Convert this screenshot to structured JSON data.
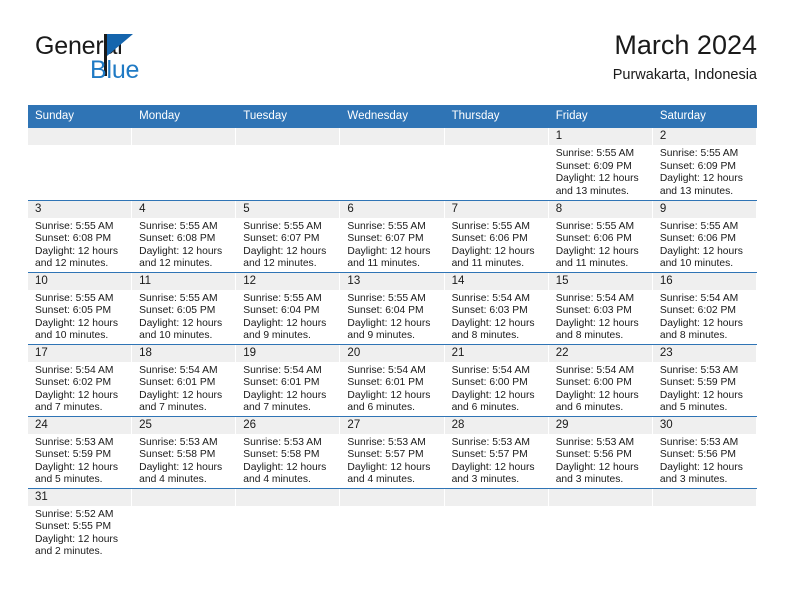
{
  "brand": {
    "name_top": "General",
    "name_bottom": "Blue",
    "accent_color": "#1f7ac4",
    "triangle_color": "#1565ad"
  },
  "header": {
    "title": "March 2024",
    "subtitle": "Purwakarta, Indonesia"
  },
  "theme": {
    "header_blue": "#2f74b5",
    "daynum_gray": "#efefef",
    "divider_blue": "#2f74b5"
  },
  "weekday_headers": [
    "Sunday",
    "Monday",
    "Tuesday",
    "Wednesday",
    "Thursday",
    "Friday",
    "Saturday"
  ],
  "weeks": [
    [
      {
        "day": "",
        "blank": true,
        "sunrise": "",
        "sunset": "",
        "daylight_line1": "",
        "daylight_line2": ""
      },
      {
        "day": "",
        "blank": true,
        "sunrise": "",
        "sunset": "",
        "daylight_line1": "",
        "daylight_line2": ""
      },
      {
        "day": "",
        "blank": true,
        "sunrise": "",
        "sunset": "",
        "daylight_line1": "",
        "daylight_line2": ""
      },
      {
        "day": "",
        "blank": true,
        "sunrise": "",
        "sunset": "",
        "daylight_line1": "",
        "daylight_line2": ""
      },
      {
        "day": "",
        "blank": true,
        "sunrise": "",
        "sunset": "",
        "daylight_line1": "",
        "daylight_line2": ""
      },
      {
        "day": "1",
        "blank": false,
        "sunrise": "Sunrise: 5:55 AM",
        "sunset": "Sunset: 6:09 PM",
        "daylight_line1": "Daylight: 12 hours",
        "daylight_line2": "and 13 minutes."
      },
      {
        "day": "2",
        "blank": false,
        "sunrise": "Sunrise: 5:55 AM",
        "sunset": "Sunset: 6:09 PM",
        "daylight_line1": "Daylight: 12 hours",
        "daylight_line2": "and 13 minutes."
      }
    ],
    [
      {
        "day": "3",
        "blank": false,
        "sunrise": "Sunrise: 5:55 AM",
        "sunset": "Sunset: 6:08 PM",
        "daylight_line1": "Daylight: 12 hours",
        "daylight_line2": "and 12 minutes."
      },
      {
        "day": "4",
        "blank": false,
        "sunrise": "Sunrise: 5:55 AM",
        "sunset": "Sunset: 6:08 PM",
        "daylight_line1": "Daylight: 12 hours",
        "daylight_line2": "and 12 minutes."
      },
      {
        "day": "5",
        "blank": false,
        "sunrise": "Sunrise: 5:55 AM",
        "sunset": "Sunset: 6:07 PM",
        "daylight_line1": "Daylight: 12 hours",
        "daylight_line2": "and 12 minutes."
      },
      {
        "day": "6",
        "blank": false,
        "sunrise": "Sunrise: 5:55 AM",
        "sunset": "Sunset: 6:07 PM",
        "daylight_line1": "Daylight: 12 hours",
        "daylight_line2": "and 11 minutes."
      },
      {
        "day": "7",
        "blank": false,
        "sunrise": "Sunrise: 5:55 AM",
        "sunset": "Sunset: 6:06 PM",
        "daylight_line1": "Daylight: 12 hours",
        "daylight_line2": "and 11 minutes."
      },
      {
        "day": "8",
        "blank": false,
        "sunrise": "Sunrise: 5:55 AM",
        "sunset": "Sunset: 6:06 PM",
        "daylight_line1": "Daylight: 12 hours",
        "daylight_line2": "and 11 minutes."
      },
      {
        "day": "9",
        "blank": false,
        "sunrise": "Sunrise: 5:55 AM",
        "sunset": "Sunset: 6:06 PM",
        "daylight_line1": "Daylight: 12 hours",
        "daylight_line2": "and 10 minutes."
      }
    ],
    [
      {
        "day": "10",
        "blank": false,
        "sunrise": "Sunrise: 5:55 AM",
        "sunset": "Sunset: 6:05 PM",
        "daylight_line1": "Daylight: 12 hours",
        "daylight_line2": "and 10 minutes."
      },
      {
        "day": "11",
        "blank": false,
        "sunrise": "Sunrise: 5:55 AM",
        "sunset": "Sunset: 6:05 PM",
        "daylight_line1": "Daylight: 12 hours",
        "daylight_line2": "and 10 minutes."
      },
      {
        "day": "12",
        "blank": false,
        "sunrise": "Sunrise: 5:55 AM",
        "sunset": "Sunset: 6:04 PM",
        "daylight_line1": "Daylight: 12 hours",
        "daylight_line2": "and 9 minutes."
      },
      {
        "day": "13",
        "blank": false,
        "sunrise": "Sunrise: 5:55 AM",
        "sunset": "Sunset: 6:04 PM",
        "daylight_line1": "Daylight: 12 hours",
        "daylight_line2": "and 9 minutes."
      },
      {
        "day": "14",
        "blank": false,
        "sunrise": "Sunrise: 5:54 AM",
        "sunset": "Sunset: 6:03 PM",
        "daylight_line1": "Daylight: 12 hours",
        "daylight_line2": "and 8 minutes."
      },
      {
        "day": "15",
        "blank": false,
        "sunrise": "Sunrise: 5:54 AM",
        "sunset": "Sunset: 6:03 PM",
        "daylight_line1": "Daylight: 12 hours",
        "daylight_line2": "and 8 minutes."
      },
      {
        "day": "16",
        "blank": false,
        "sunrise": "Sunrise: 5:54 AM",
        "sunset": "Sunset: 6:02 PM",
        "daylight_line1": "Daylight: 12 hours",
        "daylight_line2": "and 8 minutes."
      }
    ],
    [
      {
        "day": "17",
        "blank": false,
        "sunrise": "Sunrise: 5:54 AM",
        "sunset": "Sunset: 6:02 PM",
        "daylight_line1": "Daylight: 12 hours",
        "daylight_line2": "and 7 minutes."
      },
      {
        "day": "18",
        "blank": false,
        "sunrise": "Sunrise: 5:54 AM",
        "sunset": "Sunset: 6:01 PM",
        "daylight_line1": "Daylight: 12 hours",
        "daylight_line2": "and 7 minutes."
      },
      {
        "day": "19",
        "blank": false,
        "sunrise": "Sunrise: 5:54 AM",
        "sunset": "Sunset: 6:01 PM",
        "daylight_line1": "Daylight: 12 hours",
        "daylight_line2": "and 7 minutes."
      },
      {
        "day": "20",
        "blank": false,
        "sunrise": "Sunrise: 5:54 AM",
        "sunset": "Sunset: 6:01 PM",
        "daylight_line1": "Daylight: 12 hours",
        "daylight_line2": "and 6 minutes."
      },
      {
        "day": "21",
        "blank": false,
        "sunrise": "Sunrise: 5:54 AM",
        "sunset": "Sunset: 6:00 PM",
        "daylight_line1": "Daylight: 12 hours",
        "daylight_line2": "and 6 minutes."
      },
      {
        "day": "22",
        "blank": false,
        "sunrise": "Sunrise: 5:54 AM",
        "sunset": "Sunset: 6:00 PM",
        "daylight_line1": "Daylight: 12 hours",
        "daylight_line2": "and 6 minutes."
      },
      {
        "day": "23",
        "blank": false,
        "sunrise": "Sunrise: 5:53 AM",
        "sunset": "Sunset: 5:59 PM",
        "daylight_line1": "Daylight: 12 hours",
        "daylight_line2": "and 5 minutes."
      }
    ],
    [
      {
        "day": "24",
        "blank": false,
        "sunrise": "Sunrise: 5:53 AM",
        "sunset": "Sunset: 5:59 PM",
        "daylight_line1": "Daylight: 12 hours",
        "daylight_line2": "and 5 minutes."
      },
      {
        "day": "25",
        "blank": false,
        "sunrise": "Sunrise: 5:53 AM",
        "sunset": "Sunset: 5:58 PM",
        "daylight_line1": "Daylight: 12 hours",
        "daylight_line2": "and 4 minutes."
      },
      {
        "day": "26",
        "blank": false,
        "sunrise": "Sunrise: 5:53 AM",
        "sunset": "Sunset: 5:58 PM",
        "daylight_line1": "Daylight: 12 hours",
        "daylight_line2": "and 4 minutes."
      },
      {
        "day": "27",
        "blank": false,
        "sunrise": "Sunrise: 5:53 AM",
        "sunset": "Sunset: 5:57 PM",
        "daylight_line1": "Daylight: 12 hours",
        "daylight_line2": "and 4 minutes."
      },
      {
        "day": "28",
        "blank": false,
        "sunrise": "Sunrise: 5:53 AM",
        "sunset": "Sunset: 5:57 PM",
        "daylight_line1": "Daylight: 12 hours",
        "daylight_line2": "and 3 minutes."
      },
      {
        "day": "29",
        "blank": false,
        "sunrise": "Sunrise: 5:53 AM",
        "sunset": "Sunset: 5:56 PM",
        "daylight_line1": "Daylight: 12 hours",
        "daylight_line2": "and 3 minutes."
      },
      {
        "day": "30",
        "blank": false,
        "sunrise": "Sunrise: 5:53 AM",
        "sunset": "Sunset: 5:56 PM",
        "daylight_line1": "Daylight: 12 hours",
        "daylight_line2": "and 3 minutes."
      }
    ],
    [
      {
        "day": "31",
        "blank": false,
        "sunrise": "Sunrise: 5:52 AM",
        "sunset": "Sunset: 5:55 PM",
        "daylight_line1": "Daylight: 12 hours",
        "daylight_line2": "and 2 minutes."
      },
      {
        "day": "",
        "blank": true,
        "sunrise": "",
        "sunset": "",
        "daylight_line1": "",
        "daylight_line2": ""
      },
      {
        "day": "",
        "blank": true,
        "sunrise": "",
        "sunset": "",
        "daylight_line1": "",
        "daylight_line2": ""
      },
      {
        "day": "",
        "blank": true,
        "sunrise": "",
        "sunset": "",
        "daylight_line1": "",
        "daylight_line2": ""
      },
      {
        "day": "",
        "blank": true,
        "sunrise": "",
        "sunset": "",
        "daylight_line1": "",
        "daylight_line2": ""
      },
      {
        "day": "",
        "blank": true,
        "sunrise": "",
        "sunset": "",
        "daylight_line1": "",
        "daylight_line2": ""
      },
      {
        "day": "",
        "blank": true,
        "sunrise": "",
        "sunset": "",
        "daylight_line1": "",
        "daylight_line2": ""
      }
    ]
  ]
}
